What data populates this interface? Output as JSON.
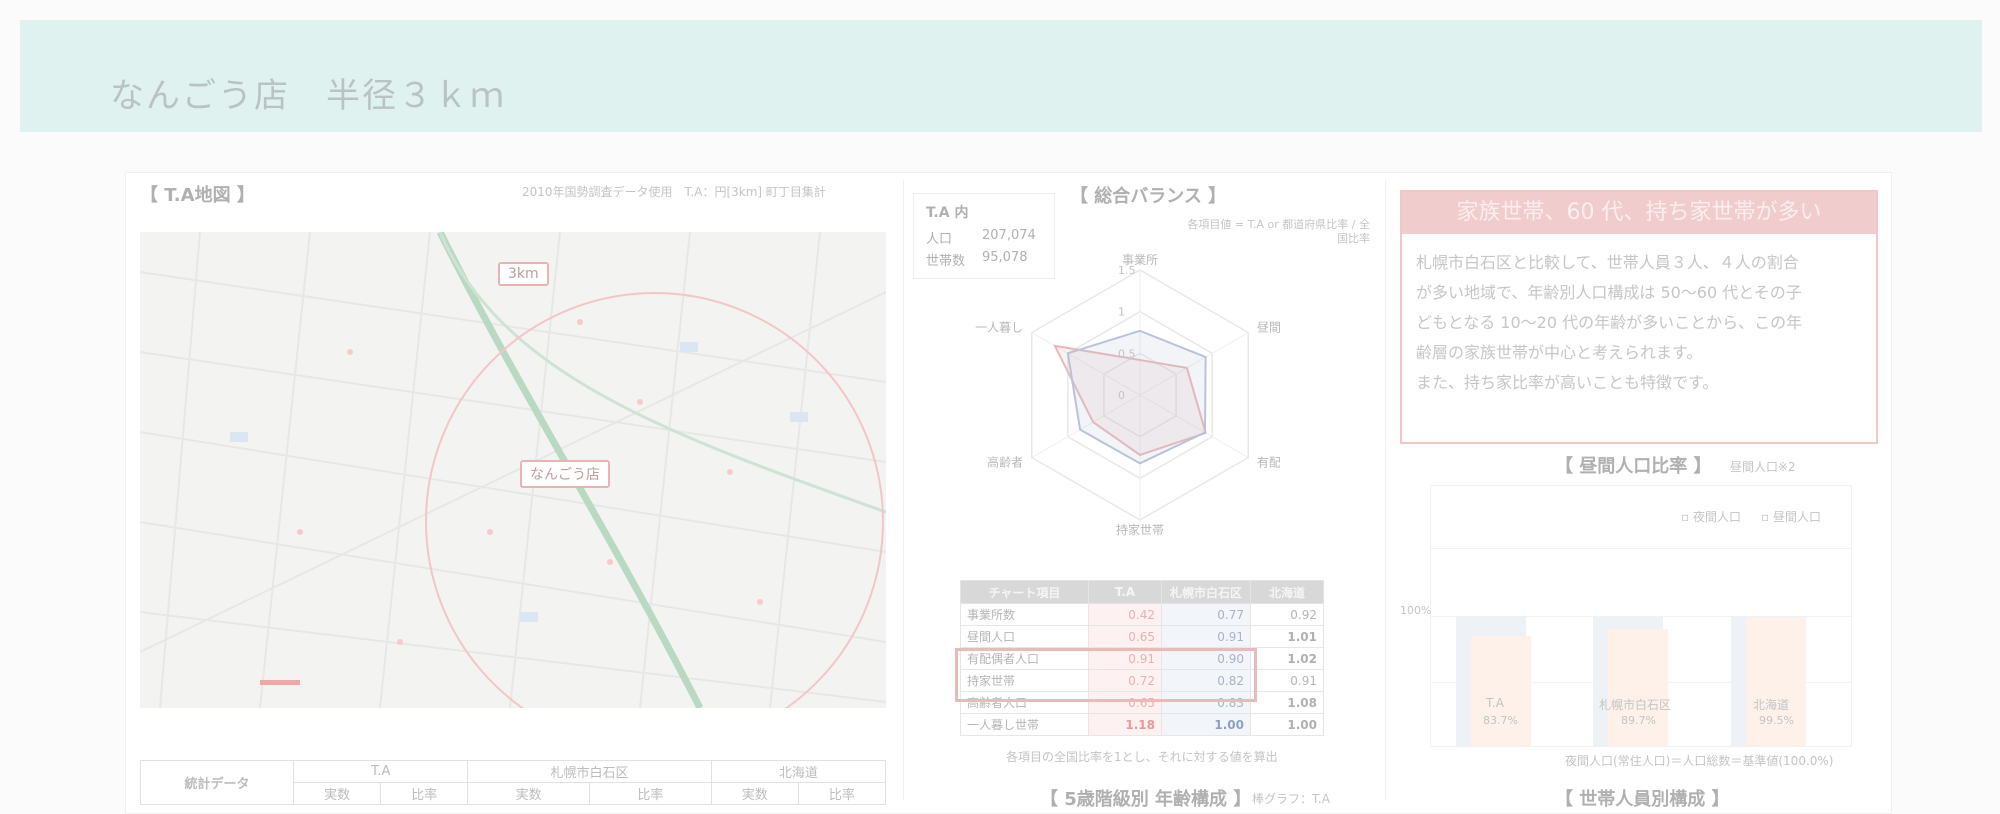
{
  "header": {
    "title": "なんごう店　半径３ｋｍ"
  },
  "map_section": {
    "title": "【 T.A地図 】",
    "note": "2010年国勢調査データ使用　T.A：円[3km] 町丁目集計",
    "radius_label": "3km",
    "store_label": "なんごう店"
  },
  "stats": {
    "title": "T.A 内",
    "population_label": "人口",
    "population_value": "207,074",
    "households_label": "世帯数",
    "households_value": "95,078"
  },
  "balance": {
    "title": "【 総合バランス 】",
    "legend_note": "各項目値 = T.A or 都道府県比率 / 全国比率",
    "axis_labels": [
      "事業所",
      "昼間人口",
      "有配偶者",
      "持家世帯",
      "高齢者",
      "一人暮し"
    ],
    "ring_labels": [
      "1.5",
      "1",
      "0.5",
      "0"
    ],
    "series": [
      {
        "values": [
          0.42,
          0.65,
          0.91,
          0.72,
          0.65,
          1.18
        ],
        "color": "#e9b8b8"
      },
      {
        "values": [
          0.77,
          0.91,
          0.9,
          0.82,
          0.83,
          1.0
        ],
        "color": "#b9c3d8"
      }
    ],
    "footnote": "各項目の全国比率を1とし、それに対する値を算出"
  },
  "chart_table": {
    "headers": [
      "チャート項目",
      "T.A",
      "札幌市白石区",
      "北海道"
    ],
    "rows": [
      [
        "事業所数",
        "0.42",
        "0.77",
        "0.92"
      ],
      [
        "昼間人口",
        "0.65",
        "0.91",
        "1.01"
      ],
      [
        "有配偶者人口",
        "0.91",
        "0.90",
        "1.02"
      ],
      [
        "持家世帯",
        "0.72",
        "0.82",
        "0.91"
      ],
      [
        "高齢者人口",
        "0.65",
        "0.83",
        "1.08"
      ],
      [
        "一人暮し世帯",
        "1.18",
        "1.00",
        "1.00"
      ]
    ]
  },
  "insight": {
    "headline": "家族世帯、60 代、持ち家世帯が多い",
    "lines": [
      "札幌市白石区と比較して、世帯人員３人、４人の割合",
      "が多い地域で、年齢別人口構成は 50〜60 代とその子",
      "どもとなる 10〜20 代の年齢が多いことから、この年",
      "齢層の家族世帯が中心と考えられます。",
      "また、持ち家比率が高いことも特徴です。"
    ]
  },
  "daytime": {
    "title": "【 昼間人口比率 】",
    "note": "昼間人口※2",
    "legend": [
      "夜間人口",
      "昼間人口"
    ],
    "ytick": "100%",
    "footnote": "夜間人口(常住人口)＝人口総数＝基準値(100.0%)",
    "categories": [
      "T.A",
      "札幌市白石区",
      "北海道"
    ],
    "values_label": [
      "83.7%",
      "89.7%",
      "99.5%"
    ]
  },
  "bottom_table": {
    "title": "統計データ",
    "groups": [
      "T.A",
      "札幌市白石区",
      "北海道"
    ],
    "sub": [
      "実数",
      "比率"
    ]
  },
  "lower_titles": {
    "age": "【 5歳階級別 年齢構成 】",
    "age_note": "棒グラフ：T.A",
    "household": "【 世帯人員別構成 】"
  }
}
